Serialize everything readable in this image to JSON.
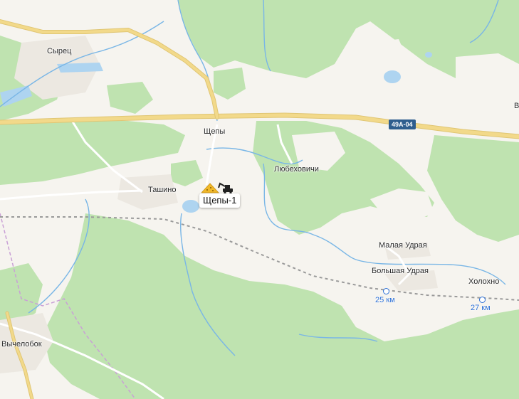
{
  "map": {
    "colors": {
      "forest": "#bfe3b0",
      "open": "#f6f4ef",
      "water": "#aed4f0",
      "river": "#79b6e6",
      "road_major": "#f2d98a",
      "rail": "#9a9a9a",
      "admin_border": "#c9a0d6",
      "km_marker": "#2b6fd6"
    },
    "road_shield": "49А-04",
    "places": {
      "syrets": "Сырец",
      "shchepy": "Щепы",
      "lyubekhovichi": "Любеховичи",
      "tashino": "Ташино",
      "malaya_udraya": "Малая Удрая",
      "bolshaya_udraya": "Большая Удрая",
      "kholokhno": "Холохно",
      "vychelobok": "Вычелобок",
      "edge_letter": "В"
    },
    "selected_object": {
      "label": "Щепы-1",
      "icon": "sand-pit-excavator-icon"
    },
    "km_markers": [
      {
        "label": "25 км"
      },
      {
        "label": "27 км"
      }
    ]
  }
}
